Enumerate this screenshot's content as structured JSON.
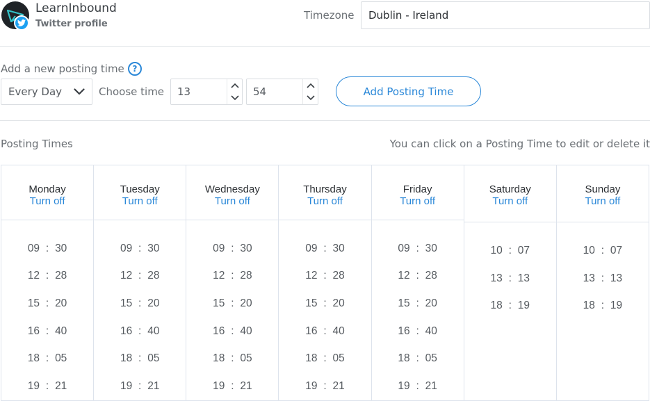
{
  "profile": {
    "name": "LearnInbound",
    "subtitle": "Twitter profile"
  },
  "timezone": {
    "label": "Timezone",
    "value": "Dublin - Ireland"
  },
  "add_section": {
    "label": "Add a new posting time",
    "help_glyph": "?",
    "frequency": "Every Day",
    "choose_label": "Choose time",
    "hour": "13",
    "minute": "54",
    "button_label": "Add Posting Time"
  },
  "posting_times": {
    "label": "Posting Times",
    "hint": "You can click on a Posting Time to edit or delete it",
    "days": [
      {
        "name": "Monday",
        "toggle": "Turn off",
        "times": [
          [
            "09",
            "30"
          ],
          [
            "12",
            "28"
          ],
          [
            "15",
            "20"
          ],
          [
            "16",
            "40"
          ],
          [
            "18",
            "05"
          ],
          [
            "19",
            "21"
          ]
        ]
      },
      {
        "name": "Tuesday",
        "toggle": "Turn off",
        "times": [
          [
            "09",
            "30"
          ],
          [
            "12",
            "28"
          ],
          [
            "15",
            "20"
          ],
          [
            "16",
            "40"
          ],
          [
            "18",
            "05"
          ],
          [
            "19",
            "21"
          ]
        ]
      },
      {
        "name": "Wednesday",
        "toggle": "Turn off",
        "times": [
          [
            "09",
            "30"
          ],
          [
            "12",
            "28"
          ],
          [
            "15",
            "20"
          ],
          [
            "16",
            "40"
          ],
          [
            "18",
            "05"
          ],
          [
            "19",
            "21"
          ]
        ]
      },
      {
        "name": "Thursday",
        "toggle": "Turn off",
        "times": [
          [
            "09",
            "30"
          ],
          [
            "12",
            "28"
          ],
          [
            "15",
            "20"
          ],
          [
            "16",
            "40"
          ],
          [
            "18",
            "05"
          ],
          [
            "19",
            "21"
          ]
        ]
      },
      {
        "name": "Friday",
        "toggle": "Turn off",
        "times": [
          [
            "09",
            "30"
          ],
          [
            "12",
            "28"
          ],
          [
            "15",
            "20"
          ],
          [
            "16",
            "40"
          ],
          [
            "18",
            "05"
          ],
          [
            "19",
            "21"
          ]
        ]
      },
      {
        "name": "Saturday",
        "toggle": "Turn off",
        "times": [
          [
            "10",
            "07"
          ],
          [
            "13",
            "13"
          ],
          [
            "18",
            "19"
          ]
        ]
      },
      {
        "name": "Sunday",
        "toggle": "Turn off",
        "times": [
          [
            "10",
            "07"
          ],
          [
            "13",
            "13"
          ],
          [
            "18",
            "19"
          ]
        ]
      }
    ]
  },
  "colors": {
    "accent": "#2b88d8",
    "twitter": "#1da1f2",
    "border": "#dde3ec"
  }
}
